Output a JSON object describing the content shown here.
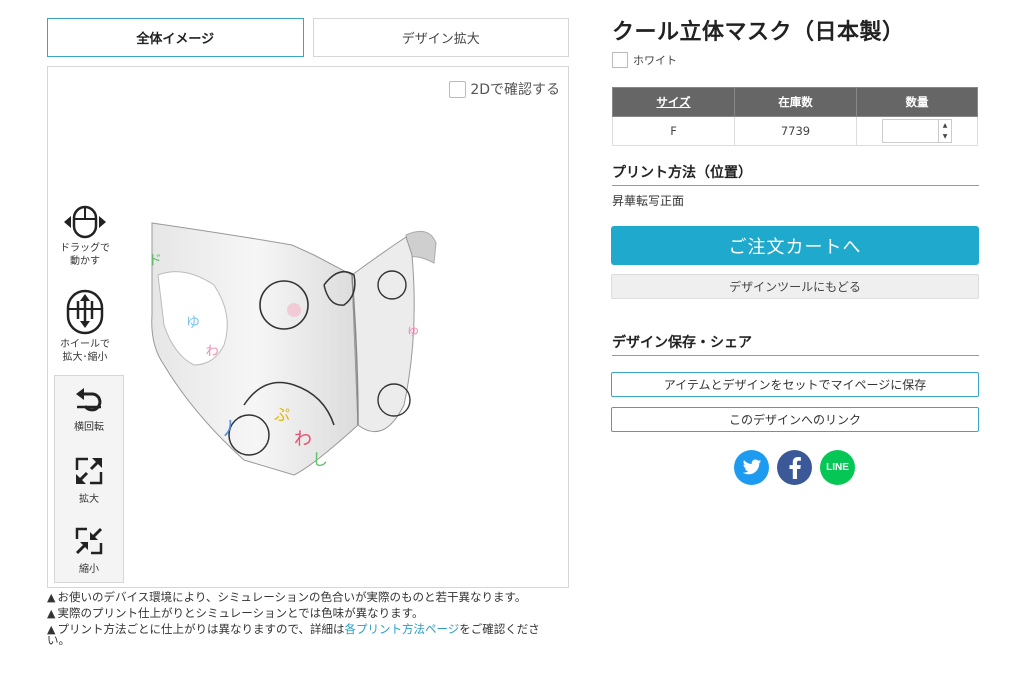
{
  "tabs": [
    {
      "label": "全体イメージ",
      "active": true
    },
    {
      "label": "デザイン拡大",
      "active": false
    }
  ],
  "viewer": {
    "check_2d_label": "2Dで確認する",
    "controls": {
      "drag_label_1": "ドラッグで",
      "drag_label_2": "動かす",
      "wheel_label_1": "ホイールで",
      "wheel_label_2": "拡大･縮小",
      "rotate_label": "横回転",
      "zoom_in_label": "拡大",
      "zoom_out_label": "縮小"
    }
  },
  "notes": {
    "n1": "お使いのデバイス環境により、シミュレーションの色合いが実際のものと若干異なります。",
    "n2": "実際のプリント仕上がりとシミュレーションとでは色味が異なります。",
    "n3_a": "プリント方法ごとに仕上がりは異なりますので、詳細は",
    "n3_link": "各プリント方法ページ",
    "n3_b": "をご確認ください。"
  },
  "product": {
    "title": "クール立体マスク（日本製）",
    "color": "ホワイト"
  },
  "stock_table": {
    "headers": [
      "サイズ",
      "在庫数",
      "数量"
    ],
    "rows": [
      {
        "size": "F",
        "stock": "7739",
        "qty": ""
      }
    ]
  },
  "print_method": {
    "heading": "プリント方法（位置）",
    "value": "昇華転写正面"
  },
  "buttons": {
    "cart": "ご注文カートへ",
    "back_to_tool": "デザインツールにもどる"
  },
  "share": {
    "heading": "デザイン保存・シェア",
    "save_label": "アイテムとデザインをセットでマイページに保存",
    "link_label": "このデザインへのリンク",
    "line_text": "LINE"
  },
  "colors": {
    "accent": "#1fa9cc",
    "twitter": "#1d9bf0",
    "facebook": "#3b5998",
    "line": "#06c755"
  }
}
